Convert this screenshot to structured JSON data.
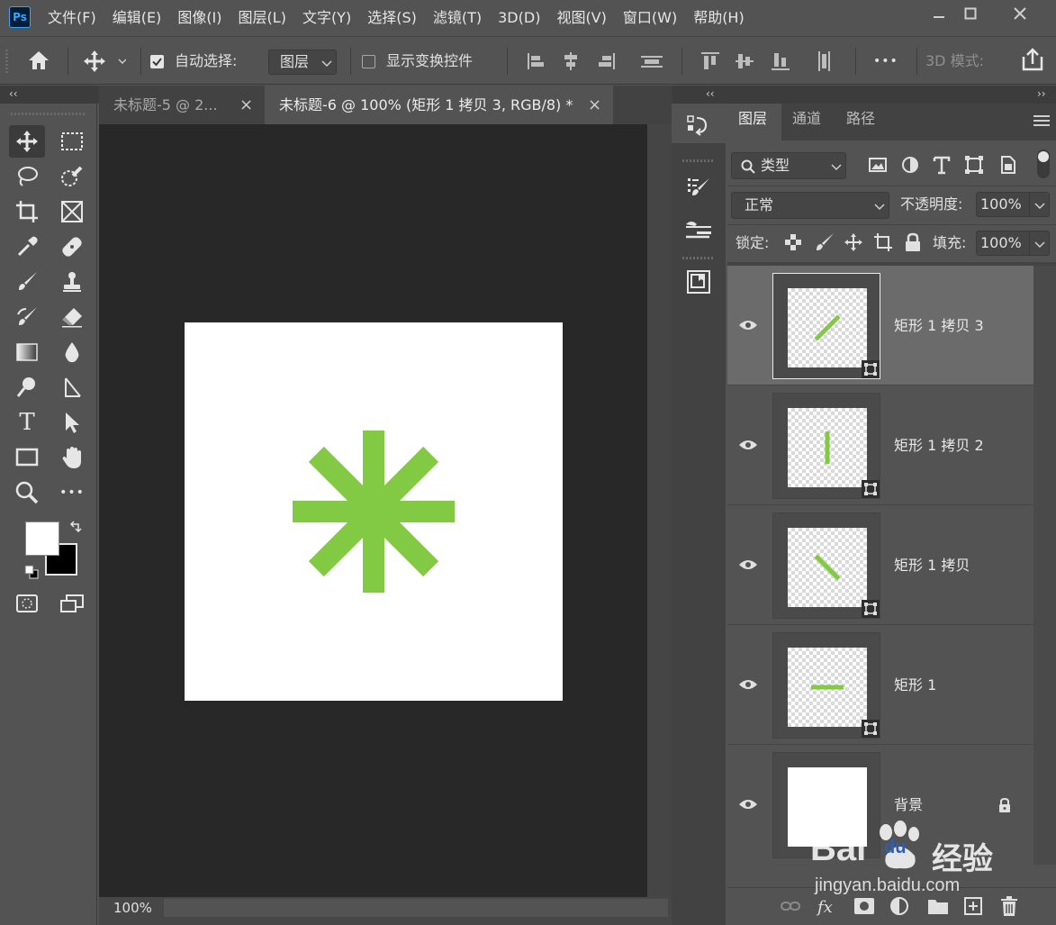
{
  "app": {
    "logo_text": "Ps"
  },
  "menu": [
    "文件(F)",
    "编辑(E)",
    "图像(I)",
    "图层(L)",
    "文字(Y)",
    "选择(S)",
    "滤镜(T)",
    "3D(D)",
    "视图(V)",
    "窗口(W)",
    "帮助(H)"
  ],
  "options_bar": {
    "auto_select_label": "自动选择:",
    "auto_select_checked": true,
    "auto_select_target": "图层",
    "show_transform_label": "显示变换控件",
    "show_transform_checked": false,
    "more_label": "•••",
    "mode_3d_label": "3D 模式:"
  },
  "panel_collapse": {
    "left": "‹‹",
    "mid": "‹‹",
    "right": "››"
  },
  "document_tabs": [
    {
      "label": "未标题-5 @ 2...",
      "active": false,
      "close": "×"
    },
    {
      "label": "未标题-6 @ 100% (矩形 1 拷贝 3, RGB/8) *",
      "active": true,
      "close": "×"
    }
  ],
  "status_bar": {
    "zoom": "100%"
  },
  "colors": {
    "accent_green": "#82c944",
    "foreground": "#ffffff",
    "background": "#000000",
    "canvas_bg": "#282828",
    "ui_bg": "#535353"
  },
  "tools": [
    [
      "move-icon",
      "marquee-icon"
    ],
    [
      "lasso-icon",
      "quick-select-icon"
    ],
    [
      "crop-icon",
      "frame-icon"
    ],
    [
      "eyedropper-icon",
      "healing-icon"
    ],
    [
      "brush-icon",
      "stamp-icon"
    ],
    [
      "history-brush-icon",
      "eraser-icon"
    ],
    [
      "gradient-icon",
      "blur-icon"
    ],
    [
      "dodge-icon",
      "pen-icon"
    ],
    [
      "type-icon",
      "path-select-icon"
    ],
    [
      "rectangle-icon",
      "hand-icon"
    ],
    [
      "zoom-icon",
      "more-tools-icon"
    ]
  ],
  "tool_more_label": "•••",
  "type_tool_glyph": "T",
  "layers_panel": {
    "tabs": [
      "图层",
      "通道",
      "路径"
    ],
    "filter_label": "类型",
    "blend_mode": "正常",
    "opacity_label": "不透明度:",
    "opacity_value": "100%",
    "lock_label": "锁定:",
    "fill_label": "填充:",
    "fill_value": "100%",
    "layers": [
      {
        "name": "矩形 1 拷贝 3",
        "selected": true,
        "type": "smart",
        "stroke_angle": -45,
        "visible": true
      },
      {
        "name": "矩形 1 拷贝 2",
        "selected": false,
        "type": "smart",
        "stroke_angle": 90,
        "visible": true
      },
      {
        "name": "矩形 1 拷贝",
        "selected": false,
        "type": "smart",
        "stroke_angle": 45,
        "visible": true
      },
      {
        "name": "矩形 1",
        "selected": false,
        "type": "smart",
        "stroke_angle": 0,
        "visible": true
      },
      {
        "name": "背景",
        "selected": false,
        "type": "background",
        "locked": true,
        "visible": true
      }
    ]
  },
  "watermark": {
    "brand": "Bai",
    "brand_tail": "du",
    "product": "经验",
    "url": "jingyan.baidu.com"
  }
}
